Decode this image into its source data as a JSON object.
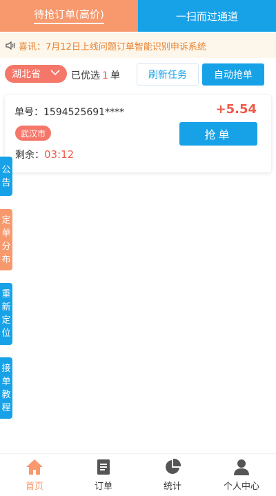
{
  "tabs": [
    {
      "label": "待抢订单(高价)"
    },
    {
      "label": "一扫而过通道"
    }
  ],
  "notice": {
    "text": "喜讯：7月12日上线问题订单智能识别申诉系统",
    "icon": "speaker-icon"
  },
  "filter": {
    "province": "湖北省",
    "selected_prefix": "已优选",
    "selected_count": "1",
    "selected_suffix": "单",
    "refresh_label": "刷新任务",
    "auto_label": "自动抢单"
  },
  "order": {
    "number_label": "单号：1594525691****",
    "city": "武汉市",
    "remain_label": "剩余：",
    "remain_time": "03:12",
    "price": "+5.54",
    "grab_label": "抢单"
  },
  "side_tabs": [
    {
      "label": "公告",
      "color": "#17a2e8"
    },
    {
      "label": "定单分布",
      "color": "#f7986d"
    },
    {
      "label": "重新定位",
      "color": "#17a2e8"
    },
    {
      "label": "接单教程",
      "color": "#17a2e8"
    }
  ],
  "nav": [
    {
      "label": "首页",
      "icon": "home-icon"
    },
    {
      "label": "订单",
      "icon": "document-icon"
    },
    {
      "label": "统计",
      "icon": "pie-chart-icon"
    },
    {
      "label": "个人中心",
      "icon": "user-icon"
    }
  ],
  "colors": {
    "blue": "#17a2e8",
    "orange": "#f7986d",
    "red": "#f05a4a"
  }
}
